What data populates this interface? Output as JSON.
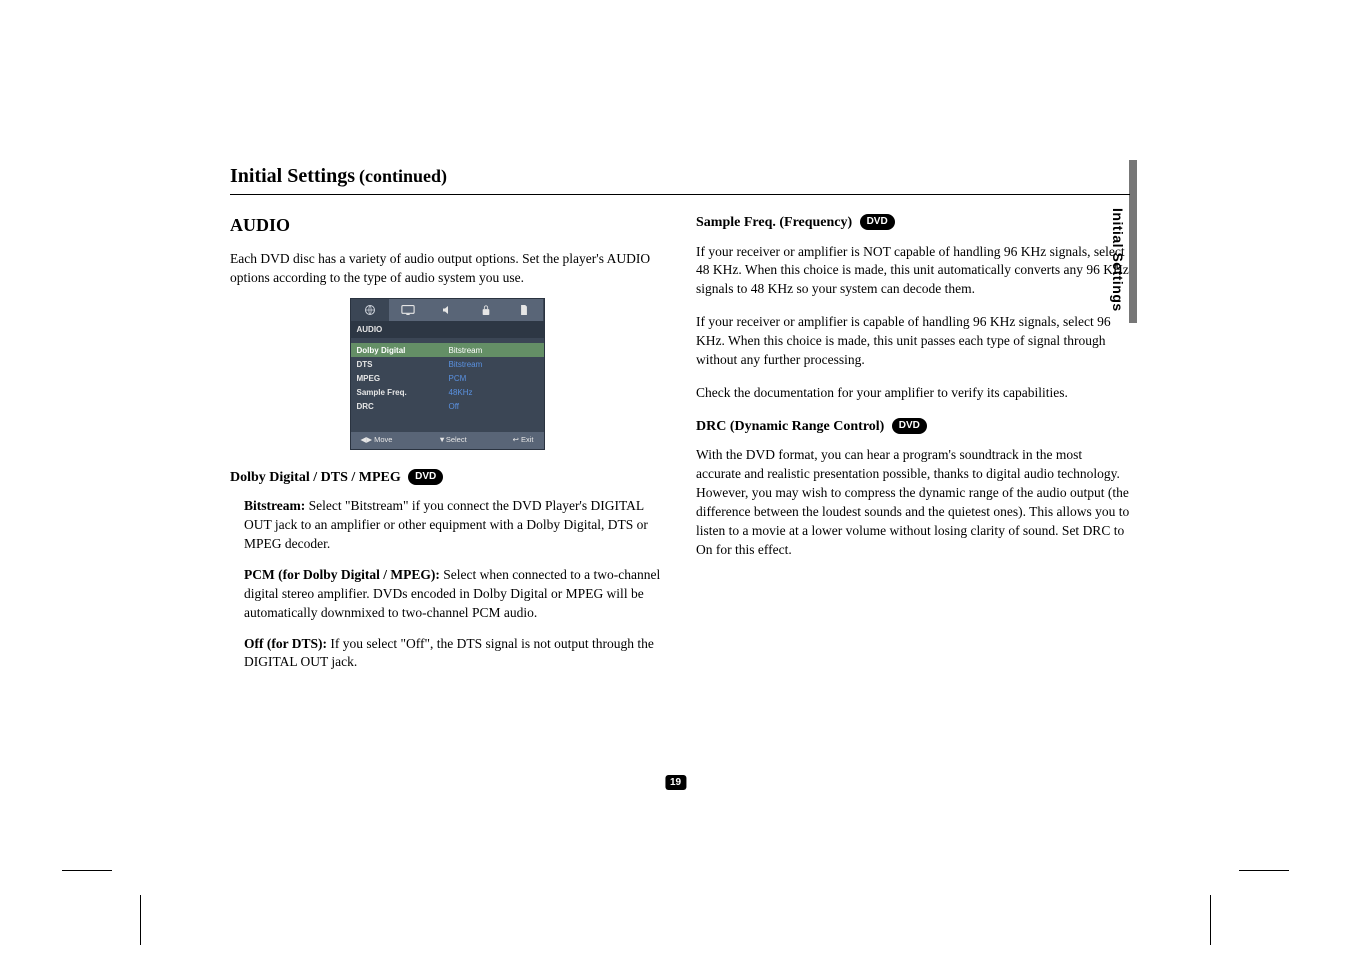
{
  "header": {
    "title": "Initial Settings",
    "continued": "(continued)"
  },
  "sideTab": "Initial Settings",
  "pageNumber": "19",
  "left": {
    "heading": "AUDIO",
    "intro": "Each DVD disc has a variety of audio output options. Set the player's AUDIO options according to the type of audio system you use.",
    "osd": {
      "panelTitle": "AUDIO",
      "items": [
        {
          "label": "Dolby Digital",
          "value": "Bitstream",
          "selected": true
        },
        {
          "label": "DTS",
          "value": "Bitstream",
          "selected": false
        },
        {
          "label": "MPEG",
          "value": "PCM",
          "selected": false
        },
        {
          "label": "Sample Freq.",
          "value": "48KHz",
          "selected": false
        },
        {
          "label": "DRC",
          "value": "Off",
          "selected": false
        }
      ],
      "footer": {
        "move": "◀▶ Move",
        "select": "▼Select",
        "exit": "↩ Exit"
      }
    },
    "sub1": {
      "title": "Dolby Digital / DTS / MPEG",
      "badge": "DVD"
    },
    "p_bit_label": "Bitstream:",
    "p_bit_text": " Select \"Bitstream\" if you connect the DVD Player's DIGITAL OUT jack to an amplifier or other equipment with a Dolby Digital, DTS or MPEG decoder.",
    "p_pcm_label": "PCM (for Dolby Digital / MPEG):",
    "p_pcm_text": " Select when connected to a two-channel digital stereo amplifier. DVDs encoded in Dolby Digital or MPEG will be automatically downmixed to two-channel PCM audio.",
    "p_off_label": "Off (for DTS):",
    "p_off_text": " If you select \"Off\", the DTS signal is not output through the DIGITAL OUT jack."
  },
  "right": {
    "sub1": {
      "title": "Sample Freq. (Frequency)",
      "badge": "DVD"
    },
    "p1": "If your receiver or amplifier is NOT capable of handling 96 KHz signals, select 48 KHz. When this choice is made, this unit automatically converts any 96 KHz signals to 48 KHz so your system can decode them.",
    "p2": "If your receiver or amplifier is capable of handling 96 KHz signals, select 96 KHz. When this choice is made, this unit passes each type of signal through without any further processing.",
    "p3": "Check the documentation for your amplifier to verify its capabilities.",
    "sub2": {
      "title": "DRC (Dynamic Range Control)",
      "badge": "DVD"
    },
    "p4": "With the DVD format, you can hear a program's soundtrack in the most accurate and realistic presentation possible, thanks to digital audio technology. However, you may wish to compress the dynamic range of the audio output (the difference between the loudest sounds and the quietest ones). This allows you to listen to a movie at a lower volume without losing clarity of sound. Set DRC to On for this effect."
  }
}
